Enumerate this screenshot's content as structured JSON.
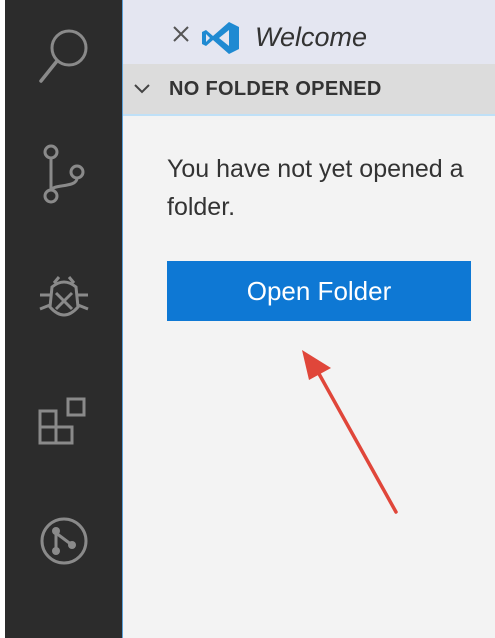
{
  "activity_bar": {
    "items": [
      {
        "icon": "search-icon"
      },
      {
        "icon": "source-control-icon"
      },
      {
        "icon": "debug-icon"
      },
      {
        "icon": "extensions-icon"
      },
      {
        "icon": "remote-icon"
      }
    ]
  },
  "tab": {
    "close_glyph": "×",
    "logo_icon": "vscode-logo-icon",
    "title": "Welcome"
  },
  "explorer": {
    "chevron_icon": "chevron-down-icon",
    "section_title": "NO FOLDER OPENED",
    "message": "You have not yet opened a folder.",
    "open_folder_label": "Open Folder"
  },
  "annotation": {
    "arrow_color": "#e0463a"
  },
  "colors": {
    "activity_bar": "#2c2c2c",
    "sidebar": "#f3f3f3",
    "button": "#0e78d4",
    "accent_border": "#5aa0d8"
  }
}
